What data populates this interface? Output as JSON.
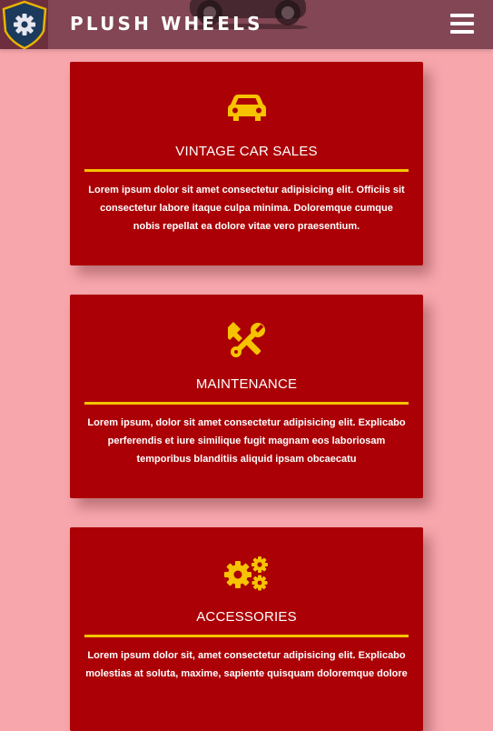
{
  "header": {
    "brand": "PLUSH WHEELS",
    "logo_icon": "shield-gear-icon",
    "menu_icon": "hamburger-menu-icon"
  },
  "colors": {
    "page_background": "#f7a6ac",
    "header_background": "#783e4d",
    "card_background": "#ab0005",
    "accent": "#f6c300",
    "text": "#ffffff"
  },
  "services": [
    {
      "icon": "car-icon",
      "title": "VINTAGE CAR SALES",
      "text": "Lorem ipsum dolor sit amet consectetur adipisicing elit. Officiis sit consectetur labore itaque culpa minima. Doloremque cumque nobis repellat ea dolore vitae vero praesentium."
    },
    {
      "icon": "wrench-screwdriver-icon",
      "title": "MAINTENANCE",
      "text": "Lorem ipsum, dolor sit amet consectetur adipisicing elit. Explicabo perferendis et iure similique fugit magnam eos laboriosam temporibus blanditiis aliquid ipsam obcaecatu"
    },
    {
      "icon": "gears-icon",
      "title": "ACCESSORIES",
      "text": "Lorem ipsum dolor sit, amet consectetur adipisicing elit. Explicabo molestias at soluta, maxime, sapiente quisquam doloremque dolore"
    }
  ]
}
